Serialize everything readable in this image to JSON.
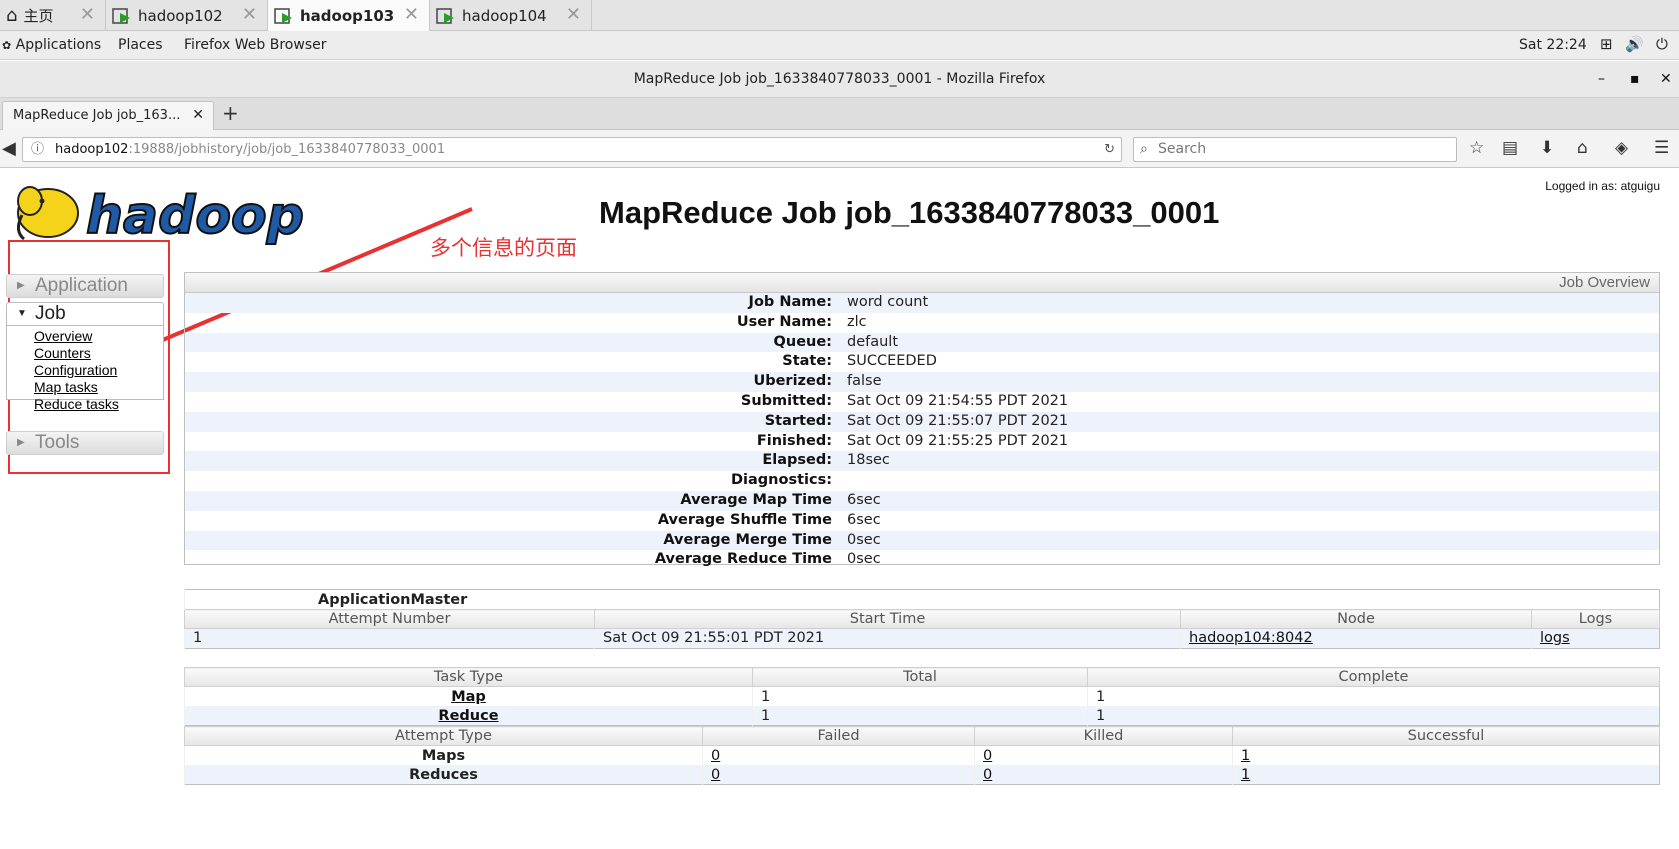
{
  "vm_tabs": [
    {
      "label": "主页",
      "active": false
    },
    {
      "label": "hadoop102",
      "active": false
    },
    {
      "label": "hadoop103",
      "active": true
    },
    {
      "label": "hadoop104",
      "active": false
    }
  ],
  "gnome": {
    "applications": "Applications",
    "places": "Places",
    "browser": "Firefox Web Browser",
    "clock": "Sat 22:24"
  },
  "window_title": "MapReduce Job job_1633840778033_0001 - Mozilla Firefox",
  "browser": {
    "tab_label": "MapReduce Job job_163...",
    "url_host": "hadoop102",
    "url_path": ":19888/jobhistory/job/job_1633840778033_0001",
    "search_placeholder": "Search"
  },
  "page": {
    "logged_in": "Logged in as: atguigu",
    "logo_text": "hadoop",
    "title": "MapReduce Job job_1633840778033_0001",
    "annotation": "多个信息的页面"
  },
  "nav": {
    "application": "Application",
    "job": "Job",
    "job_links": [
      "Overview",
      "Counters",
      "Configuration",
      "Map tasks",
      "Reduce tasks"
    ],
    "tools": "Tools"
  },
  "overview": {
    "header": "Job Overview",
    "rows": [
      {
        "key": "Job Name:",
        "value": "word count"
      },
      {
        "key": "User Name:",
        "value": "zlc"
      },
      {
        "key": "Queue:",
        "value": "default"
      },
      {
        "key": "State:",
        "value": "SUCCEEDED"
      },
      {
        "key": "Uberized:",
        "value": "false"
      },
      {
        "key": "Submitted:",
        "value": "Sat Oct 09 21:54:55 PDT 2021"
      },
      {
        "key": "Started:",
        "value": "Sat Oct 09 21:55:07 PDT 2021"
      },
      {
        "key": "Finished:",
        "value": "Sat Oct 09 21:55:25 PDT 2021"
      },
      {
        "key": "Elapsed:",
        "value": "18sec"
      },
      {
        "key": "Diagnostics:",
        "value": ""
      },
      {
        "key": "Average Map Time",
        "value": "6sec"
      },
      {
        "key": "Average Shuffle Time",
        "value": "6sec"
      },
      {
        "key": "Average Merge Time",
        "value": "0sec"
      },
      {
        "key": "Average Reduce Time",
        "value": "0sec"
      }
    ]
  },
  "am": {
    "title": "ApplicationMaster",
    "headers": [
      "Attempt Number",
      "Start Time",
      "Node",
      "Logs"
    ],
    "row": {
      "attempt": "1",
      "start": "Sat Oct 09 21:55:01 PDT 2021",
      "node": "hadoop104:8042",
      "logs": "logs"
    }
  },
  "tasks": {
    "headers": [
      "Task Type",
      "Total",
      "Complete"
    ],
    "rows": [
      {
        "type": "Map",
        "total": "1",
        "complete": "1"
      },
      {
        "type": "Reduce",
        "total": "1",
        "complete": "1"
      }
    ],
    "attempt_headers": [
      "Attempt Type",
      "Failed",
      "Killed",
      "Successful"
    ],
    "attempt_rows": [
      {
        "type": "Maps",
        "failed": "0",
        "killed": "0",
        "successful": "1"
      },
      {
        "type": "Reduces",
        "failed": "0",
        "killed": "0",
        "successful": "1"
      }
    ]
  },
  "colors": {
    "annotation_red": "#e83232",
    "row_stripe": "#eef3fb"
  }
}
